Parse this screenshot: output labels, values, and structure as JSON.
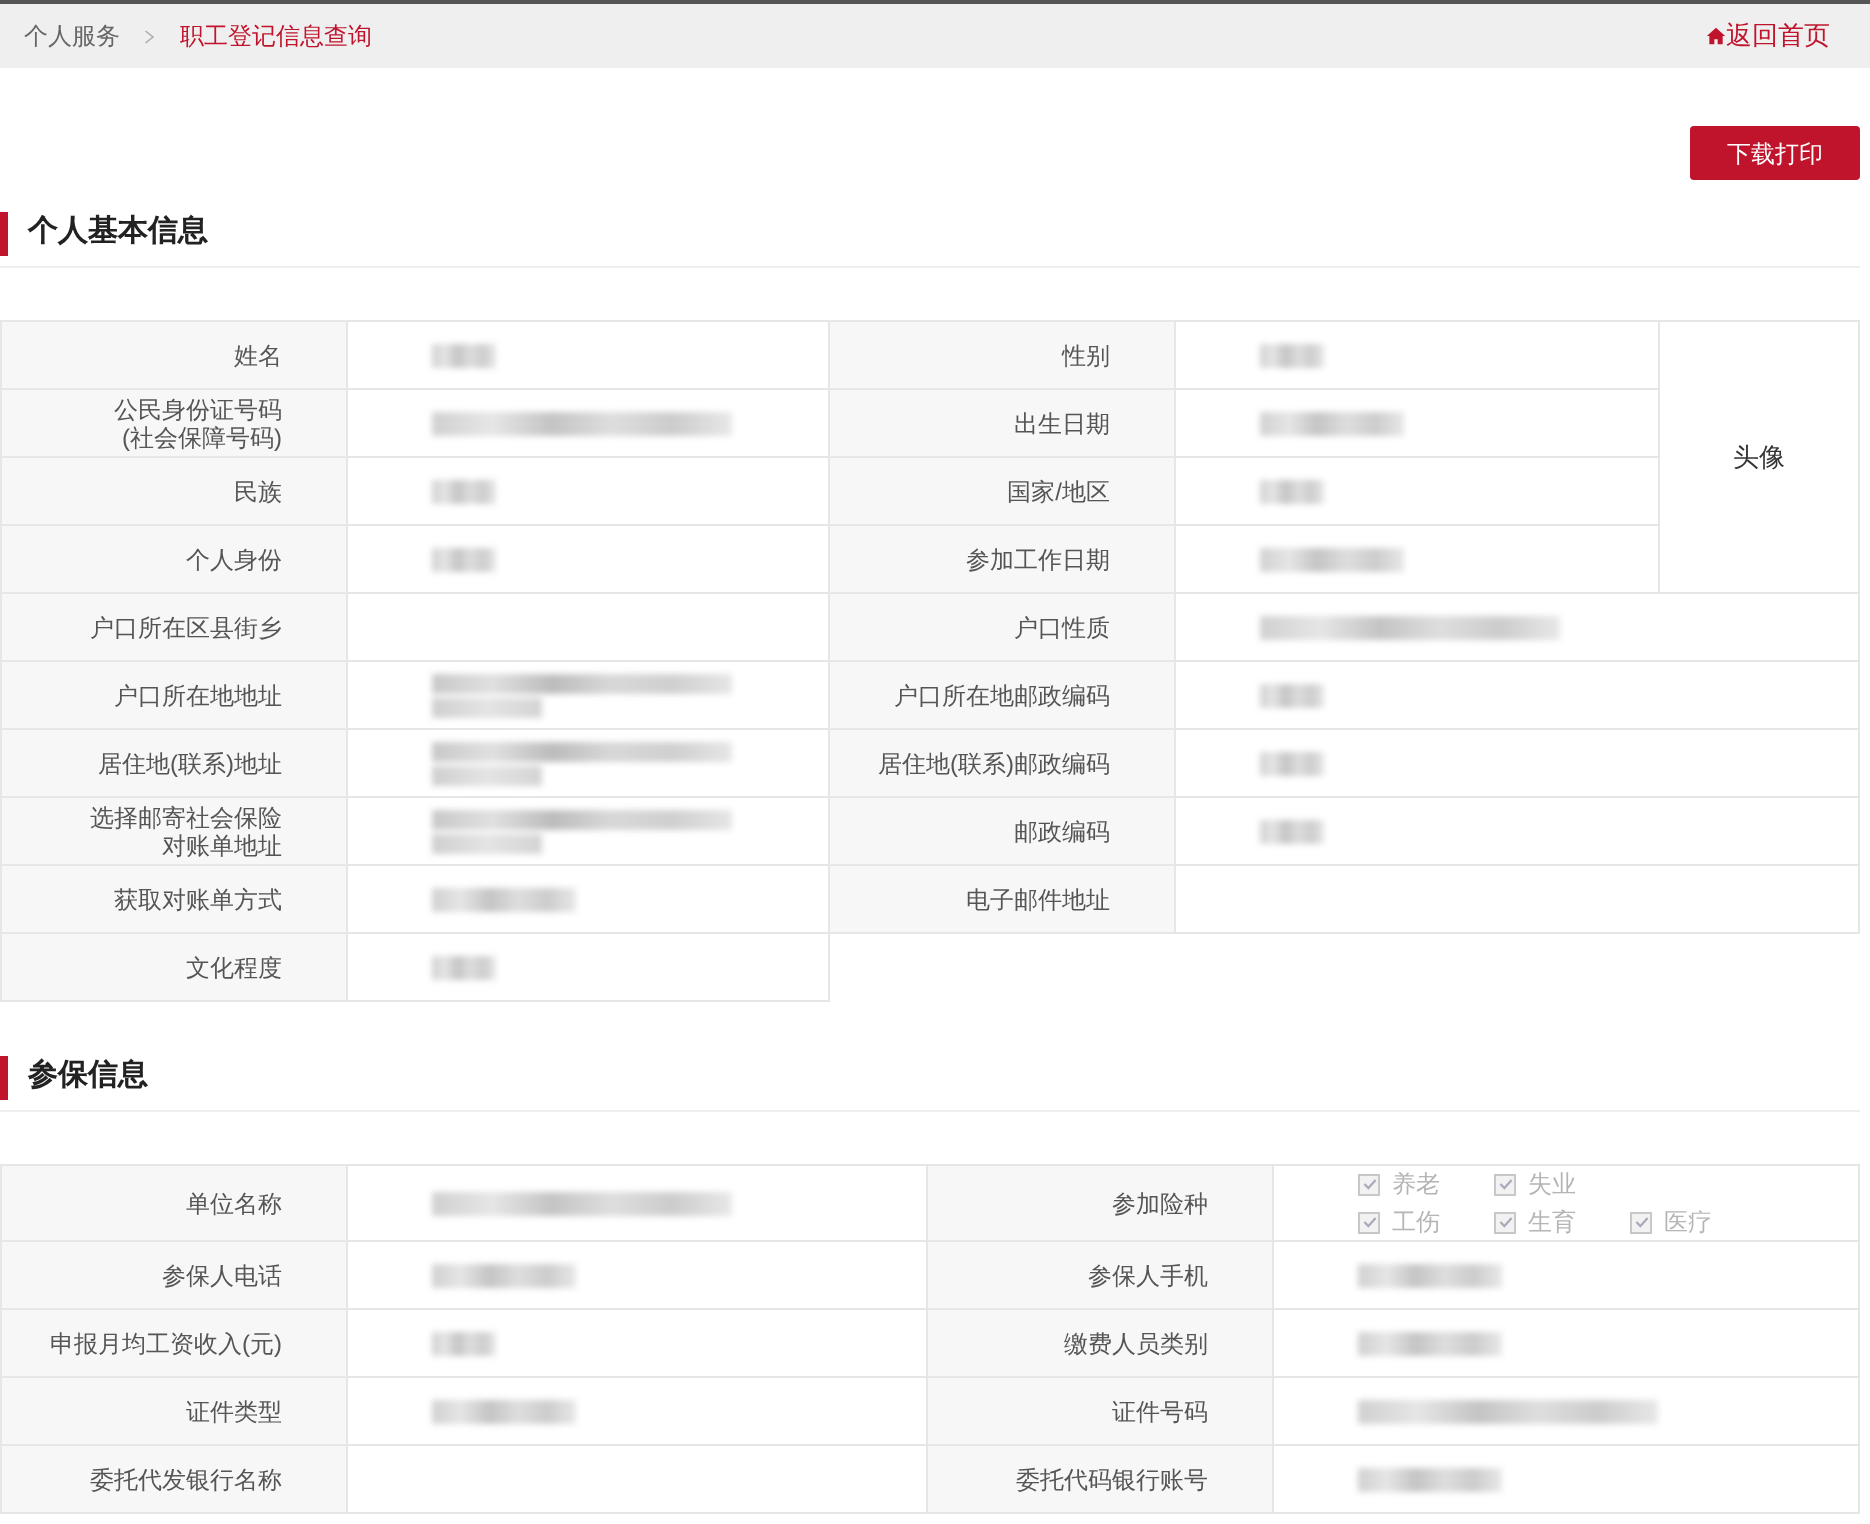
{
  "breadcrumb": [
    {
      "label": "个人服务",
      "selected": false
    },
    {
      "label": "职工登记信息查询",
      "selected": true
    }
  ],
  "home_link": "返回首页",
  "download_button": "下载打印",
  "sections": [
    {
      "title": "个人基本信息",
      "photo_label": "头像",
      "rows": [
        [
          {
            "label": [
              "姓名"
            ],
            "value": {
              "kind": "blur"
            }
          },
          {
            "label": [
              "性别"
            ],
            "value": {
              "kind": "blur"
            }
          }
        ],
        [
          {
            "label": [
              "公民身份证号码",
              "(社会保障号码)"
            ],
            "value": {
              "kind": "blurlong"
            }
          },
          {
            "label": [
              "出生日期"
            ],
            "value": {
              "kind": "blurmid"
            }
          }
        ],
        [
          {
            "label": [
              "民族"
            ],
            "value": {
              "kind": "blur"
            }
          },
          {
            "label": [
              "国家/地区"
            ],
            "value": {
              "kind": "blur"
            }
          }
        ],
        [
          {
            "label": [
              "个人身份"
            ],
            "value": {
              "kind": "blur"
            }
          },
          {
            "label": [
              "参加工作日期"
            ],
            "value": {
              "kind": "blurmid"
            }
          }
        ],
        [
          {
            "label": [
              "户口所在区县街乡"
            ],
            "value": {
              "kind": "empty"
            }
          },
          {
            "label": [
              "户口性质"
            ],
            "value": {
              "kind": "blurlong"
            }
          }
        ],
        [
          {
            "label": [
              "户口所在地地址"
            ],
            "value": {
              "kind": "address"
            }
          },
          {
            "label": [
              "户口所在地邮政编码"
            ],
            "value": {
              "kind": "blur"
            }
          }
        ],
        [
          {
            "label": [
              "居住地(联系)地址"
            ],
            "value": {
              "kind": "address"
            }
          },
          {
            "label": [
              "居住地(联系)邮政编码"
            ],
            "value": {
              "kind": "blur"
            }
          }
        ],
        [
          {
            "label": [
              "选择邮寄社会保险",
              "对账单地址"
            ],
            "value": {
              "kind": "address"
            }
          },
          {
            "label": [
              "邮政编码"
            ],
            "value": {
              "kind": "blur"
            }
          }
        ],
        [
          {
            "label": [
              "获取对账单方式"
            ],
            "value": {
              "kind": "blurmid"
            }
          },
          {
            "label": [
              "电子邮件地址"
            ],
            "value": {
              "kind": "empty"
            }
          }
        ],
        [
          {
            "label": [
              "文化程度"
            ],
            "value": {
              "kind": "blur"
            }
          }
        ]
      ]
    },
    {
      "title": "参保信息",
      "rows": [
        [
          {
            "label": [
              "单位名称"
            ],
            "value": {
              "kind": "blurlong"
            }
          },
          {
            "label": [
              "参加险种"
            ],
            "value": {
              "kind": "checkboxes",
              "lines": [
                [
                  {
                    "label": "养老",
                    "checked": true,
                    "disabled": true
                  },
                  {
                    "label": "失业",
                    "checked": true,
                    "disabled": true
                  }
                ],
                [
                  {
                    "label": "工伤",
                    "checked": true,
                    "disabled": true
                  },
                  {
                    "label": "生育",
                    "checked": true,
                    "disabled": true
                  },
                  {
                    "label": "医疗",
                    "checked": true,
                    "disabled": true
                  }
                ]
              ]
            }
          }
        ],
        [
          {
            "label": [
              "参保人电话"
            ],
            "value": {
              "kind": "blurmid"
            }
          },
          {
            "label": [
              "参保人手机"
            ],
            "value": {
              "kind": "blurmid"
            }
          }
        ],
        [
          {
            "label": [
              "申报月均工资收入(元)"
            ],
            "value": {
              "kind": "blur"
            }
          },
          {
            "label": [
              "缴费人员类别"
            ],
            "value": {
              "kind": "blurmid"
            }
          }
        ],
        [
          {
            "label": [
              "证件类型"
            ],
            "value": {
              "kind": "blurmid"
            }
          },
          {
            "label": [
              "证件号码"
            ],
            "value": {
              "kind": "blurlong"
            }
          }
        ],
        [
          {
            "label": [
              "委托代发银行名称"
            ],
            "value": {
              "kind": "empty"
            }
          },
          {
            "label": [
              "委托代码银行账号"
            ],
            "value": {
              "kind": "blurmid"
            }
          }
        ]
      ]
    }
  ]
}
